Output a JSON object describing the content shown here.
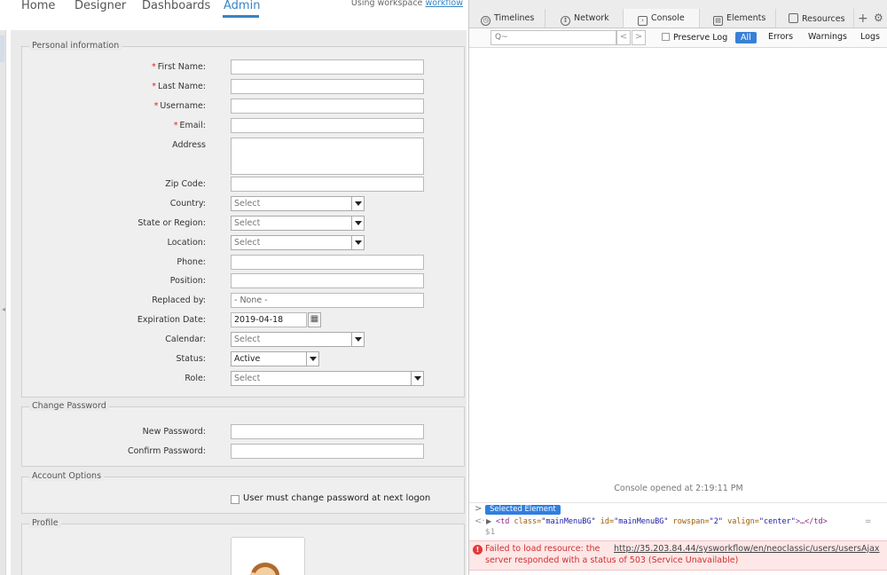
{
  "nav": {
    "items": [
      "Home",
      "Designer",
      "Dashboards",
      "Admin"
    ],
    "workspace_prefix": "Using workspace",
    "workspace_name": "workflow"
  },
  "personal": {
    "legend": "Personal information",
    "first_name_label": "First Name:",
    "last_name_label": "Last Name:",
    "username_label": "Username:",
    "email_label": "Email:",
    "address_label": "Address",
    "zip_label": "Zip Code:",
    "country_label": "Country:",
    "country_value": "Select",
    "state_label": "State or Region:",
    "state_value": "Select",
    "location_label": "Location:",
    "location_value": "Select",
    "phone_label": "Phone:",
    "position_label": "Position:",
    "replaced_label": "Replaced by:",
    "replaced_value": "- None -",
    "expiration_label": "Expiration Date:",
    "expiration_value": "2019-04-18",
    "calendar_label": "Calendar:",
    "calendar_value": "Select",
    "status_label": "Status:",
    "status_value": "Active",
    "role_label": "Role:",
    "role_value": "Select",
    "required_mark": "*"
  },
  "password": {
    "legend": "Change Password",
    "new_label": "New Password:",
    "confirm_label": "Confirm Password:"
  },
  "account": {
    "legend": "Account Options",
    "must_change_label": "User must change password at next logon"
  },
  "profile": {
    "legend": "Profile"
  },
  "devtools": {
    "tabs": [
      "Timelines",
      "Network",
      "Console",
      "Elements",
      "Resources"
    ],
    "search_placeholder": "Q~",
    "preserve_log": "Preserve Log",
    "levels": [
      "All",
      "Errors",
      "Warnings",
      "Logs"
    ],
    "console_opened": "Console opened at 2:19:11 PM",
    "selected_element": "Selected Element",
    "node_ref": "$1",
    "code": {
      "open": "<td",
      "a1n": "class=",
      "a1v": "\"mainMenuBG\"",
      "a2n": "id=",
      "a2v": "\"mainMenuBG\"",
      "a3n": "rowspan=",
      "a3v": "\"2\"",
      "a4n": "valign=",
      "a4v": "\"center\"",
      "close": ">…</td>",
      "eq": "="
    },
    "error_prefix": "Failed to load resource: the",
    "error_url": "http://35.203.84.44/sysworkflow/en/neoclassic/users/usersAjax",
    "error_suffix": "server responded with a status of 503 (Service Unavailable)"
  }
}
